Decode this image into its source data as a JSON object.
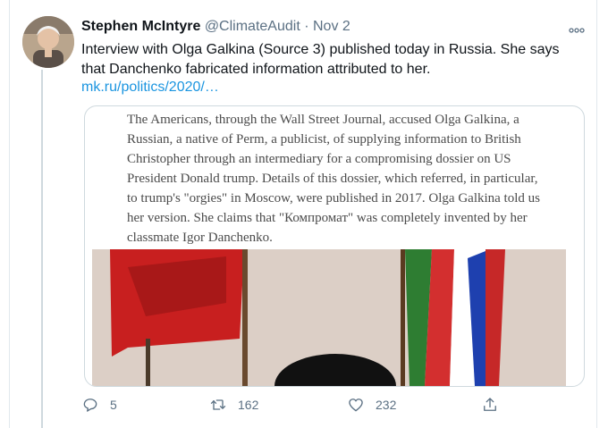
{
  "tweet": {
    "name": "Stephen McIntyre",
    "handle": "@ClimateAudit",
    "dot": "·",
    "date": "Nov 2",
    "text": "Interview with Olga Galkina (Source 3) published today in Russia. She says that Danchenko fabricated information attributed to her.",
    "link": "mk.ru/politics/2020/…"
  },
  "card": {
    "excerpt": "The Americans, through the Wall Street Journal, accused Olga Galkina, a Russian, a native of Perm, a publicist, of supplying information to British Christopher through an intermediary for a compromising dossier on US President Donald trump. Details of this dossier, which referred, in particular, to trump's \"orgies\" in Moscow, were published in 2017. Olga Galkina told us her version. She claims that \"Компромат\" was completely invented by her classmate Igor Danchenko."
  },
  "actions": {
    "replies": "5",
    "retweets": "162",
    "likes": "232"
  },
  "icons": {
    "more": "more-icon",
    "reply": "reply-icon",
    "retweet": "retweet-icon",
    "like": "like-icon",
    "share": "share-icon"
  }
}
